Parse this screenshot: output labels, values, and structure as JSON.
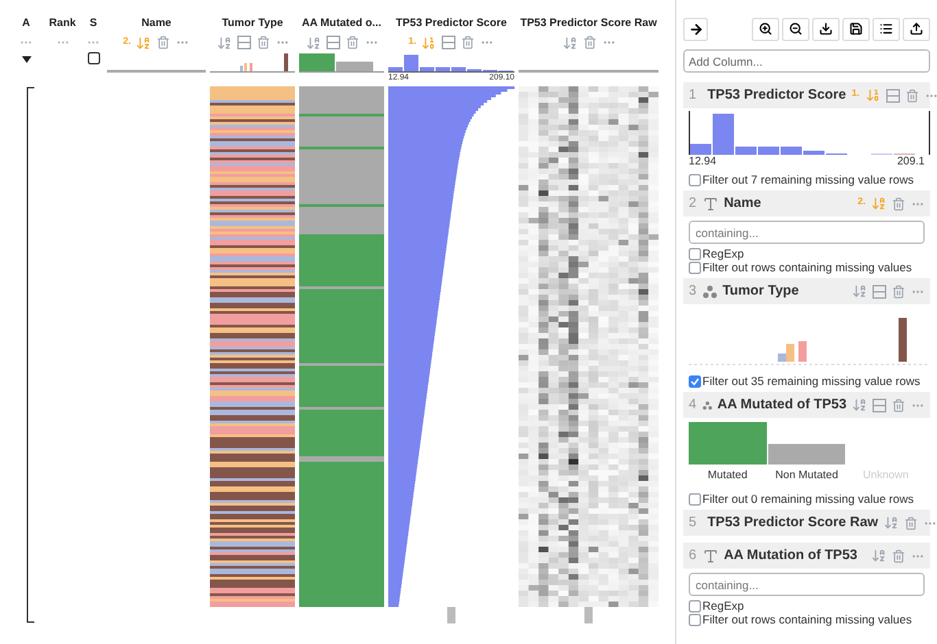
{
  "table": {
    "columns": [
      {
        "label": "A",
        "kind": "aggregate"
      },
      {
        "label": "Rank",
        "kind": "rank"
      },
      {
        "label": "S",
        "kind": "selection",
        "all_checked": false
      },
      {
        "label": "Name",
        "kind": "string",
        "sort_rank": "2."
      },
      {
        "label": "Tumor Type",
        "kind": "categorical"
      },
      {
        "label": "AA Mutated o...",
        "kind": "categorical"
      },
      {
        "label": "TP53 Predictor Score",
        "kind": "number",
        "sort_rank": "1.",
        "axis_min": "12.94",
        "axis_max": "209.10"
      },
      {
        "label": "TP53 Predictor Score Raw",
        "kind": "heatmap"
      }
    ]
  },
  "side_panel": {
    "add_column_placeholder": "Add Column...",
    "panels": [
      {
        "index": "1",
        "kind": "number",
        "title": "TP53 Predictor Score",
        "sort_rank": "1.",
        "axis_min": "12.94",
        "axis_max": "209.1",
        "filter_label": "Filter out 7 remaining missing value rows",
        "filter_checked": false
      },
      {
        "index": "2",
        "kind": "string",
        "title": "Name",
        "sort_rank": "2.",
        "placeholder": "containing...",
        "regexp_label": "RegExp",
        "regexp_checked": false,
        "filter_label": "Filter out rows containing missing values",
        "filter_checked": false
      },
      {
        "index": "3",
        "kind": "categorical",
        "title": "Tumor Type",
        "filter_label": "Filter out 35 remaining missing value rows",
        "filter_checked": true
      },
      {
        "index": "4",
        "kind": "categorical",
        "title": "AA Mutated of TP53",
        "categories": [
          {
            "label": "Mutated",
            "color": "#4ea45a",
            "disabled": false
          },
          {
            "label": "Non Mutated",
            "color": "#aaaaaa",
            "disabled": false
          },
          {
            "label": "Unknown",
            "disabled": true
          }
        ],
        "filter_label": "Filter out 0 remaining missing value rows",
        "filter_checked": false
      },
      {
        "index": "5",
        "kind": "heatmap",
        "title": "TP53 Predictor Score Raw"
      },
      {
        "index": "6",
        "kind": "string",
        "title": "AA Mutation of TP53",
        "placeholder": "containing...",
        "regexp_label": "RegExp",
        "regexp_checked": false,
        "filter_label": "Filter out rows containing missing values",
        "filter_checked": false
      }
    ]
  }
}
